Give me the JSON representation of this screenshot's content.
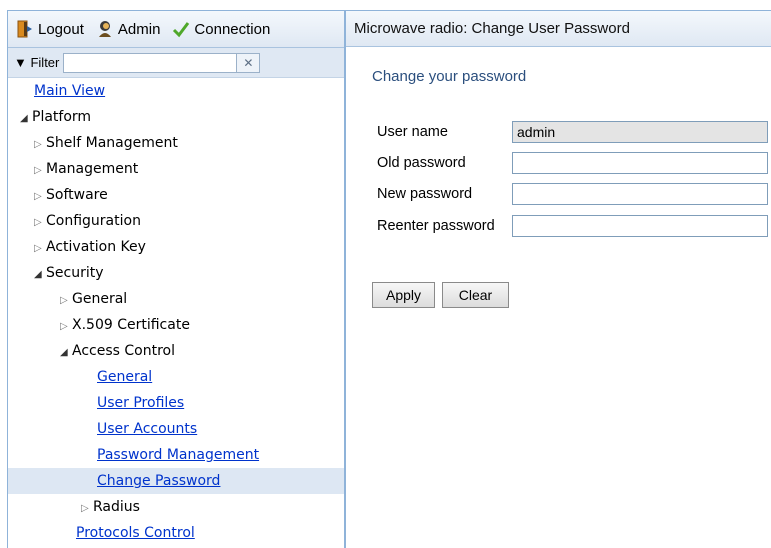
{
  "toolbar": {
    "logout_label": "Logout",
    "admin_label": "Admin",
    "connection_label": "Connection"
  },
  "filter": {
    "label": "▼ Filter",
    "value": "",
    "clear_symbol": "✕"
  },
  "tree": {
    "main_view": "Main View",
    "platform": "Platform",
    "shelf_management": "Shelf Management",
    "management": "Management",
    "software": "Software",
    "configuration": "Configuration",
    "activation_key": "Activation Key",
    "security": "Security",
    "general": "General",
    "x509": "X.509 Certificate",
    "access_control": "Access Control",
    "ac_general": "General",
    "user_profiles": "User Profiles",
    "user_accounts": "User Accounts",
    "password_management": "Password Management",
    "change_password": "Change Password",
    "radius": "Radius",
    "protocols_control": "Protocols Control"
  },
  "main": {
    "header_title": "Microwave radio: Change User Password",
    "section_title": "Change your password",
    "fields": {
      "user_name_label": "User name",
      "user_name_value": "admin",
      "old_password_label": "Old password",
      "new_password_label": "New password",
      "reenter_password_label": "Reenter password"
    },
    "apply_label": "Apply",
    "clear_label": "Clear"
  }
}
